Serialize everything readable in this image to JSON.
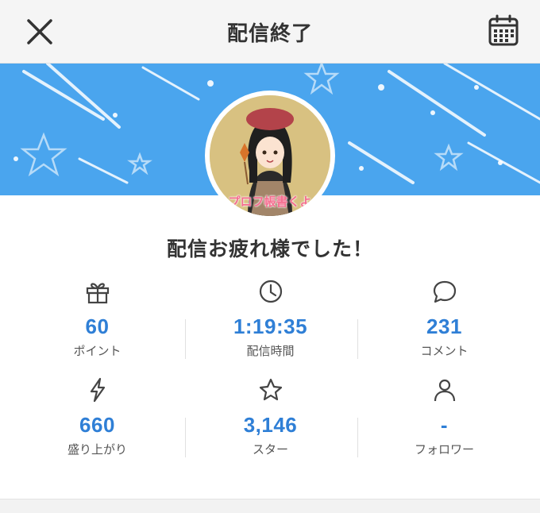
{
  "header": {
    "title": "配信終了",
    "close_icon": "close-icon",
    "calendar_icon": "calendar-icon"
  },
  "banner": {
    "color": "#4aa5ee",
    "avatar_text": "プロフ帳書くよ"
  },
  "message": "配信お疲れ様でした！",
  "stats": [
    {
      "icon": "gift-icon",
      "value": "60",
      "label": "ポイント"
    },
    {
      "icon": "clock-icon",
      "value": "1:19:35",
      "label": "配信時間"
    },
    {
      "icon": "comment-icon",
      "value": "231",
      "label": "コメント"
    },
    {
      "icon": "lightning-icon",
      "value": "660",
      "label": "盛り上がり"
    },
    {
      "icon": "star-icon",
      "value": "3,146",
      "label": "スター"
    },
    {
      "icon": "person-icon",
      "value": "-",
      "label": "フォロワー"
    }
  ],
  "colors": {
    "value": "#2f7fd6",
    "banner": "#4aa5ee"
  }
}
